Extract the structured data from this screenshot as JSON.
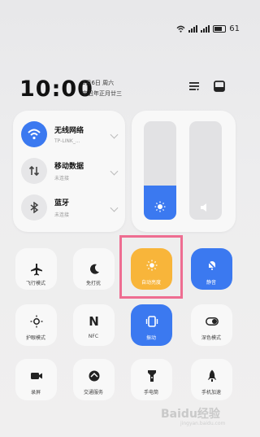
{
  "status_bar": {
    "battery": "61"
  },
  "header": {
    "time": "10:00",
    "date": "3月6日 周六",
    "lunar": "辛丑年正月廿三"
  },
  "connectivity": {
    "wifi": {
      "title": "无线网络",
      "subtitle": "TP-LINK_..."
    },
    "mobile": {
      "title": "移动数据",
      "subtitle": "未连接"
    },
    "bluetooth": {
      "title": "蓝牙",
      "subtitle": "未连接"
    }
  },
  "sliders": {
    "brightness_level": 0.35,
    "volume_level": 0.0
  },
  "tiles": {
    "airplane": "飞行模式",
    "do_not_disturb": "免打扰",
    "auto_brightness": "自动亮度",
    "mute": "静音",
    "eye_comfort": "护眼模式",
    "nfc": "NFC",
    "nfc_glyph": "N",
    "vibrate": "振动",
    "dark_mode": "深色模式",
    "screen_record": "录屏",
    "wallet": "交通服务",
    "flashlight": "手电筒",
    "game_boost": "手机加速"
  },
  "watermark": {
    "text": "Baidu经验",
    "sub": "jingyan.baidu.com"
  },
  "colors": {
    "accent": "#3b79f0",
    "active_orange": "#f8b53a",
    "highlight": "#ee6d91"
  }
}
